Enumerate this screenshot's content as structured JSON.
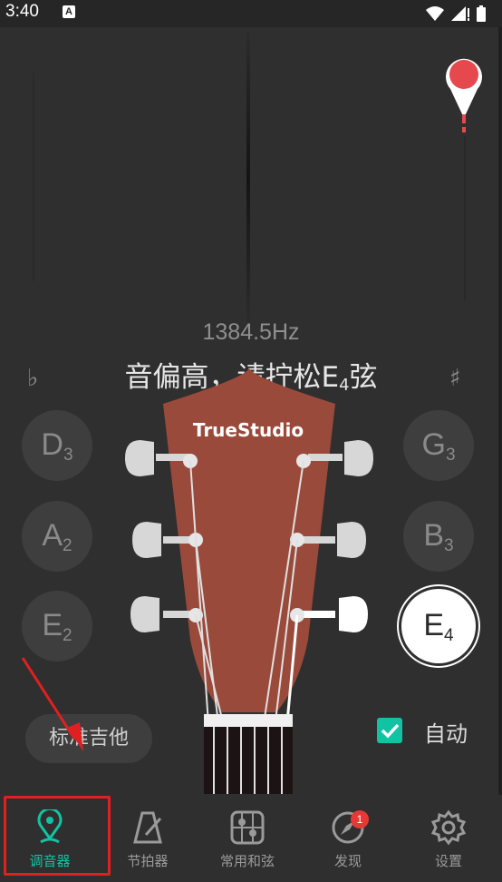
{
  "status_bar": {
    "time": "3:40",
    "app_badge": "A"
  },
  "tuner": {
    "frequency": "1384.5Hz",
    "hint_prefix": "音偏高，请拧松E",
    "hint_sub": "4",
    "hint_suffix": "弦",
    "flat": "♭",
    "sharp": "♯",
    "indicator_color": "#e5484d"
  },
  "headstock": {
    "brand": "TrueStudio"
  },
  "strings": {
    "left": [
      {
        "note": "D",
        "octave": "3"
      },
      {
        "note": "A",
        "octave": "2"
      },
      {
        "note": "E",
        "octave": "2"
      }
    ],
    "right": [
      {
        "note": "G",
        "octave": "3"
      },
      {
        "note": "B",
        "octave": "3"
      },
      {
        "note": "E",
        "octave": "4",
        "active": true
      }
    ]
  },
  "preset": {
    "label": "标准吉他"
  },
  "auto": {
    "label": "自动",
    "checked": true
  },
  "nav": {
    "items": [
      {
        "label": "调音器",
        "active": true,
        "icon": "tuner-pin-icon"
      },
      {
        "label": "节拍器",
        "icon": "metronome-icon"
      },
      {
        "label": "常用和弦",
        "icon": "chord-grid-icon"
      },
      {
        "label": "发现",
        "icon": "compass-icon",
        "badge": "1"
      },
      {
        "label": "设置",
        "icon": "gear-icon"
      }
    ]
  },
  "colors": {
    "accent": "#12c3a3",
    "background": "#2f2f2f",
    "highlight": "#e02020"
  }
}
